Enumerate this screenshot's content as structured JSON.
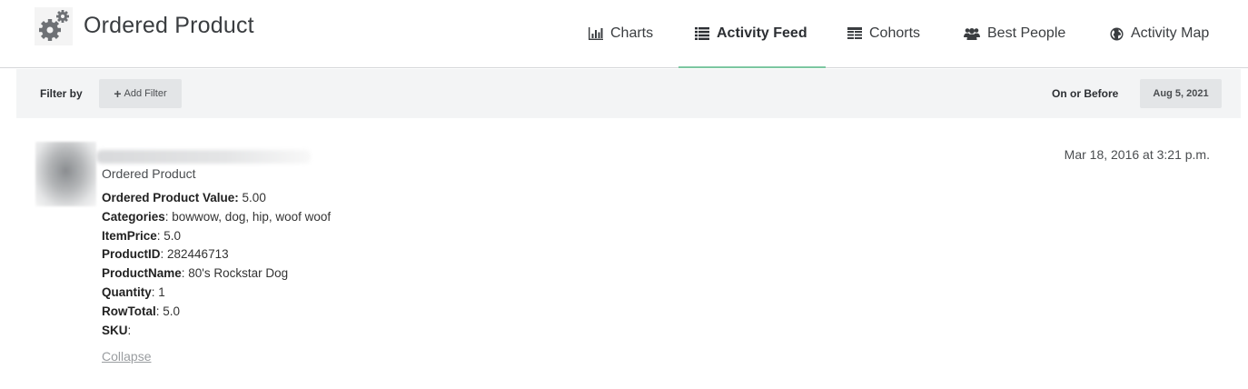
{
  "header": {
    "title": "Ordered Product",
    "logo_icon": "gears-icon"
  },
  "nav": {
    "tabs": [
      {
        "label": "Charts",
        "icon": "bar-chart-icon",
        "active": false
      },
      {
        "label": "Activity Feed",
        "icon": "list-icon",
        "active": true
      },
      {
        "label": "Cohorts",
        "icon": "table-icon",
        "active": false
      },
      {
        "label": "Best People",
        "icon": "users-icon",
        "active": false
      },
      {
        "label": "Activity Map",
        "icon": "globe-icon",
        "active": false
      }
    ]
  },
  "filter_bar": {
    "label": "Filter by",
    "add_filter_plus": "+",
    "add_filter_label": "Add Filter",
    "before_label": "On or Before",
    "date": "Aug 5, 2021"
  },
  "feed": {
    "item": {
      "event_name": "Ordered Product",
      "timestamp": "Mar 18, 2016 at 3:21 p.m.",
      "properties": [
        {
          "key": "Ordered Product Value:",
          "value": " 5.00"
        },
        {
          "key": "Categories",
          "value": ": bowwow, dog, hip, woof woof"
        },
        {
          "key": "ItemPrice",
          "value": ": 5.0"
        },
        {
          "key": "ProductID",
          "value": ": 282446713"
        },
        {
          "key": "ProductName",
          "value": ": 80's Rockstar Dog"
        },
        {
          "key": "Quantity",
          "value": ": 1"
        },
        {
          "key": "RowTotal",
          "value": ": 5.0"
        },
        {
          "key": "SKU",
          "value": ":"
        }
      ],
      "collapse_label": "Collapse"
    }
  },
  "colors": {
    "active_underline": "#7cc7a1",
    "filter_bar_bg": "#f3f4f5",
    "button_bg": "#e3e5e7"
  }
}
